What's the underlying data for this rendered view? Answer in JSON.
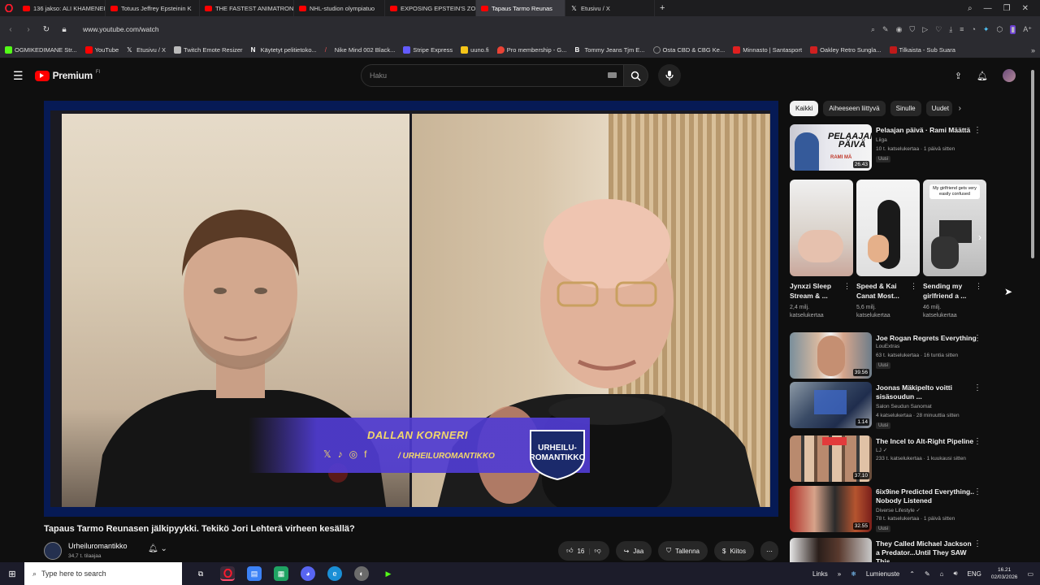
{
  "browser": {
    "tabs": [
      {
        "label": "136 jakso: ALI KHAMENEI",
        "icon": "youtube-icon"
      },
      {
        "label": "Totuus Jeffrey Epsteinin K",
        "icon": "youtube-icon"
      },
      {
        "label": "THE FASTEST ANIMATRON",
        "icon": "youtube-icon"
      },
      {
        "label": "NHL-studion olympiatuo",
        "icon": "youtube-icon"
      },
      {
        "label": "EXPOSING EPSTEIN'S ZOR",
        "icon": "youtube-icon"
      },
      {
        "label": "Tapaus Tarmo Reunas",
        "icon": "youtube-icon",
        "active": true
      },
      {
        "label": "Etusivu / X",
        "icon": "x-icon"
      }
    ],
    "url": "www.youtube.com/watch",
    "bookmarks": [
      {
        "label": "OGMIKEDIMANE Str...",
        "color": "#53fc18"
      },
      {
        "label": "YouTube",
        "color": "#ff0000"
      },
      {
        "label": "Etusivu / X",
        "color": "#000000"
      },
      {
        "label": "Twitch Emote Resizer",
        "color": "#bbbbbb"
      },
      {
        "label": "Käytetyt pelitietoko...",
        "color": "#ffffff"
      },
      {
        "label": "Nike Mind 002 Black...",
        "color": "#e05050"
      },
      {
        "label": "Stripe Express",
        "color": "#635bff"
      },
      {
        "label": "uuno.fi",
        "color": "#f5c518"
      },
      {
        "label": "Pro membership - G...",
        "color": "#ea4335"
      },
      {
        "label": "Tommy Jeans Tjm E...",
        "color": "#ffffff"
      },
      {
        "label": "Osta CBD & CBG Ke...",
        "color": "#888888"
      },
      {
        "label": "Minnasto | Santasport",
        "color": "#e02020"
      },
      {
        "label": "Oakley Retro Sungla...",
        "color": "#d02020"
      },
      {
        "label": "Tilkaista - Sub Suara",
        "color": "#c01a1a"
      }
    ]
  },
  "youtube": {
    "logo_text": "Premium",
    "logo_region": "FI",
    "search_placeholder": "Haku",
    "overlay": {
      "name": "DALLAN KORNERI",
      "handle": "/ URHEILUROMANTIKKO",
      "badge_line1": "URHEILU",
      "badge_line2": "ROMANTIKKO"
    },
    "video_title": "Tapaus Tarmo Reunasen jälkipyykki. Tekikö Jori Lehterä virheen kesällä?",
    "channel": {
      "name": "Urheiluromantikko",
      "subscribers": "34,7 t. tilaajaa"
    },
    "actions": {
      "likes": "16",
      "share": "Jaa",
      "save": "Tallenna",
      "thanks": "Kiitos"
    },
    "chips": [
      "Kaikki",
      "Aiheeseen liittyvä",
      "Sinulle",
      "Uudet"
    ],
    "recommendations": [
      {
        "title": "Pelaajan päivä · Rami Määttä",
        "channel": "Liiga",
        "meta": "10 t. katselukertaa · 1 päivä sitten",
        "new": "Uusi",
        "duration": "26.43",
        "thumb_text": "PELAAJAN PÄIVÄ",
        "thumb_sub": "RAMI MÄ"
      },
      {
        "title": "Joe Rogan Regrets Everything",
        "channel": "LouExtras",
        "meta": "63 t. katselukertaa · 16 tuntia sitten",
        "new": "Uusi",
        "duration": "39.56"
      },
      {
        "title": "Joonas Mäkipelto voitti sisäsoudun ...",
        "channel": "Salon Seudun Sanomat",
        "meta": "4 katselukertaa · 28 minuuttia sitten",
        "new": "Uusi",
        "duration": "1.14"
      },
      {
        "title": "The Incel to Alt-Right Pipeline",
        "channel": "LJ",
        "meta": "233 t. katselukertaa · 1 kuukausi sitten",
        "new": "",
        "duration": "37.10"
      },
      {
        "title": "6ix9ine Predicted Everything.. Nobody Listened",
        "channel": "Diverse Lifestyle",
        "meta": "78 t. katselukertaa · 1 päivä sitten",
        "new": "Uusi",
        "duration": "32.55"
      },
      {
        "title": "They Called Michael Jackson a Predator...Until They SAW This",
        "channel": "",
        "meta": "",
        "new": "",
        "duration": ""
      }
    ],
    "shorts": [
      {
        "title": "Jynxzi Sleep Stream & ...",
        "views": "2,4 milj.",
        "views_label": "katselukertaa"
      },
      {
        "title": "Speed & Kai Canat Most...",
        "views": "5,6 milj.",
        "views_label": "katselukertaa"
      },
      {
        "title": "Sending my girlfriend a ...",
        "views": "46 milj.",
        "views_label": "katselukertaa",
        "thumb_text": "My girlfriend gets very easily confused"
      }
    ]
  },
  "taskbar": {
    "search_placeholder": "Type here to search",
    "links": "Links",
    "weather": "Lumienuste",
    "lang": "ENG",
    "time": "16.21",
    "date": "02/03/2026"
  },
  "colors": {
    "youtube_red": "#ff0000",
    "player_border": "#061a55",
    "overlay_text": "#f3d86a",
    "overlay_band": "#5a3cd2"
  }
}
